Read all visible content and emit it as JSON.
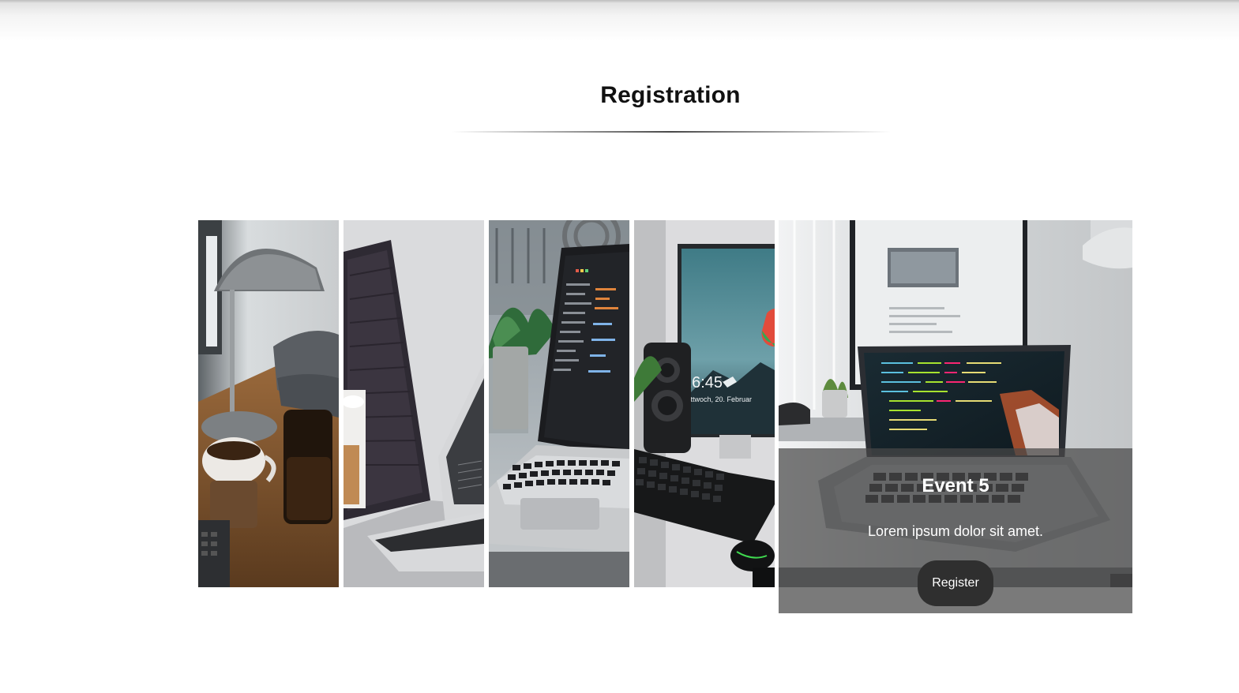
{
  "section": {
    "title": "Registration"
  },
  "gallery": {
    "images": [
      {
        "description_icon": "desk-lamp-coffee-photo"
      },
      {
        "description_icon": "laptop-speaker-photo"
      },
      {
        "description_icon": "laptop-plant-photo"
      },
      {
        "description_icon": "monitor-keyboard-photo"
      },
      {
        "description_icon": "laptop-monitor-desk-photo"
      }
    ],
    "active_event": {
      "title": "Event 5",
      "description": "Lorem ipsum dolor sit amet.",
      "button_label": "Register"
    }
  },
  "colors": {
    "overlay": "#484848",
    "button": "#2f2f2f",
    "title_text": "#111111"
  }
}
